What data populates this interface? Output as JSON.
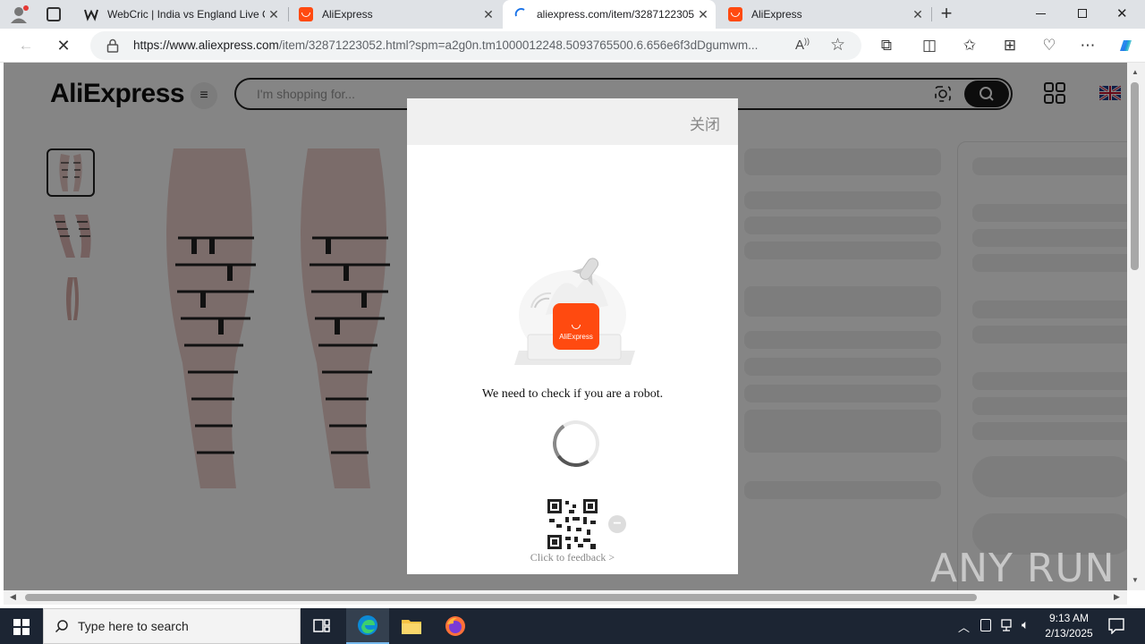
{
  "browser": {
    "tabs": [
      {
        "title": "WebCric | India vs England Live C"
      },
      {
        "title": "AliExpress"
      },
      {
        "title": "aliexpress.com/item/3287122305"
      },
      {
        "title": "AliExpress"
      }
    ],
    "url_host": "https://www.aliexpress.com",
    "url_path": "/item/32871223052.html?spm=a2g0n.tm1000012248.5093765500.6.656e6f3dDgumwm..."
  },
  "site": {
    "logo": "AliExpress",
    "search_placeholder": "I'm shopping for..."
  },
  "captcha": {
    "close_label": "关闭",
    "app_badge": "AliExpress",
    "message": "We need to check if you are a robot.",
    "feedback_label": "Click to feedback >"
  },
  "taskbar": {
    "search_placeholder": "Type here to search",
    "time": "9:13 AM",
    "date": "2/13/2025"
  },
  "watermark": "ANY RUN",
  "colors": {
    "ali_orange": "#ff4a10",
    "taskbar": "#1c2533",
    "overlay": "rgba(0,0,0,0.48)"
  }
}
